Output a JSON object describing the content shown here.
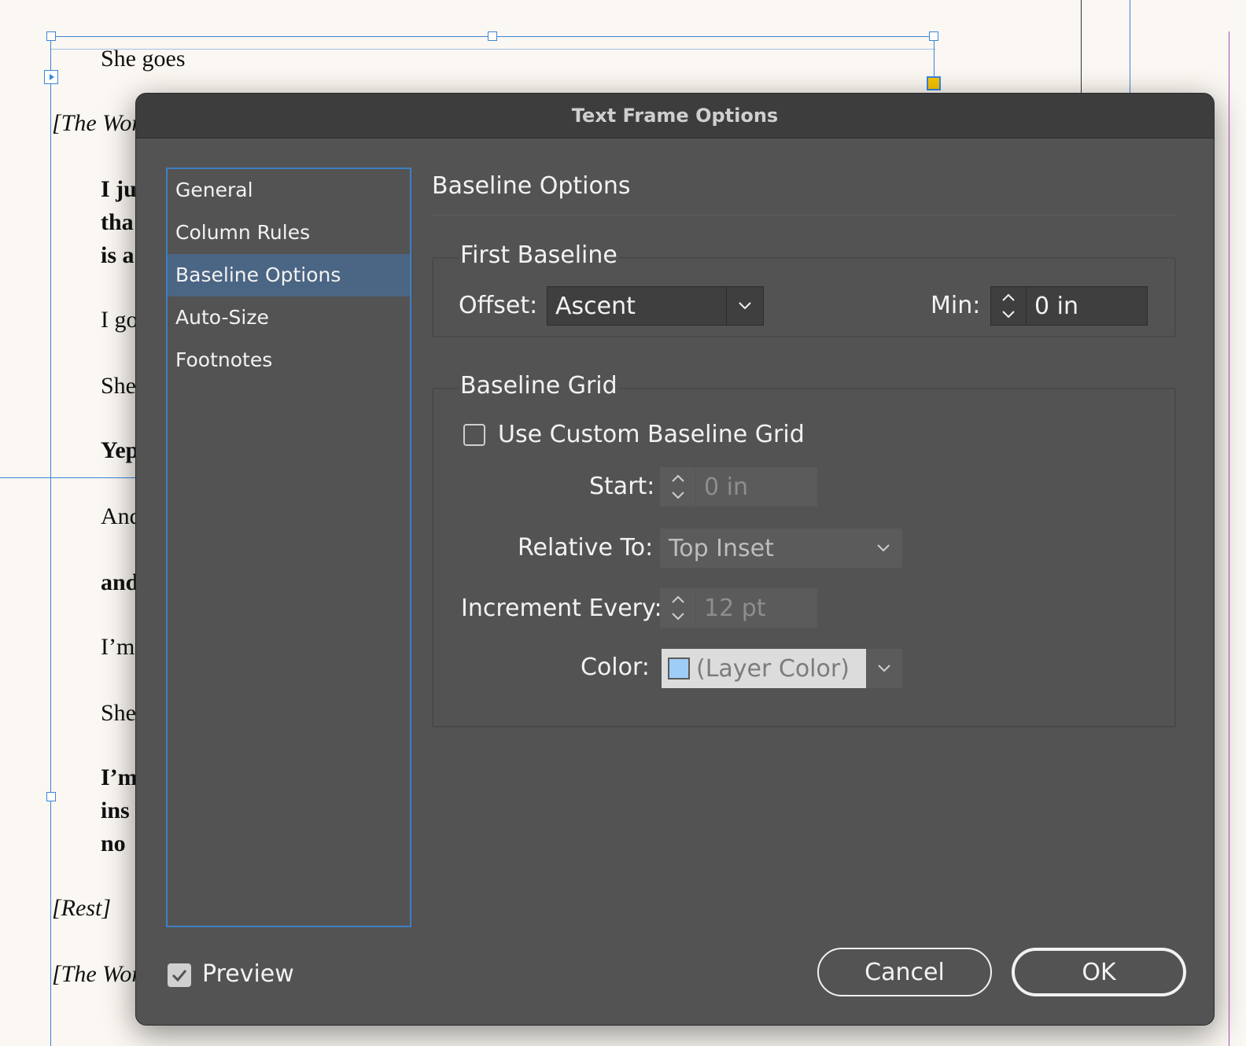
{
  "document": {
    "lines": [
      {
        "text": "She goes",
        "style": "normal"
      },
      {
        "text": "[The Wor",
        "style": "italic"
      },
      {
        "text": "I ju",
        "style": "bold"
      },
      {
        "text": "tha",
        "style": "bold"
      },
      {
        "text": "is a",
        "style": "bold"
      },
      {
        "text": "I go",
        "style": "normal"
      },
      {
        "text": "She",
        "style": "normal"
      },
      {
        "text": "Yep",
        "style": "bold"
      },
      {
        "text": "And",
        "style": "normal"
      },
      {
        "text": "and",
        "style": "bold"
      },
      {
        "text": "I’m",
        "style": "normal"
      },
      {
        "text": "She",
        "style": "normal"
      },
      {
        "text": "I’m",
        "style": "bold"
      },
      {
        "text": "ins",
        "style": "bold"
      },
      {
        "text": "no",
        "style": "bold"
      },
      {
        "text": "[Rest]",
        "style": "italic"
      },
      {
        "text": "[The Wor",
        "style": "italic"
      }
    ]
  },
  "dialog": {
    "title": "Text Frame Options",
    "nav": [
      {
        "label": "General",
        "selected": false
      },
      {
        "label": "Column Rules",
        "selected": false
      },
      {
        "label": "Baseline Options",
        "selected": true
      },
      {
        "label": "Auto-Size",
        "selected": false
      },
      {
        "label": "Footnotes",
        "selected": false
      }
    ],
    "section_title": "Baseline Options",
    "first_baseline": {
      "title": "First Baseline",
      "offset_label": "Offset:",
      "offset_value": "Ascent",
      "min_label": "Min:",
      "min_value": "0 in"
    },
    "baseline_grid": {
      "title": "Baseline Grid",
      "use_custom_label": "Use Custom Baseline Grid",
      "use_custom_checked": false,
      "start_label": "Start:",
      "start_value": "0 in",
      "relative_to_label": "Relative To:",
      "relative_to_value": "Top Inset",
      "increment_label": "Increment Every:",
      "increment_value": "12 pt",
      "color_label": "Color:",
      "color_value": "(Layer Color)",
      "color_swatch": "#9ecdf7"
    },
    "preview_label": "Preview",
    "preview_checked": true,
    "cancel_label": "Cancel",
    "ok_label": "OK"
  },
  "colors": {
    "dialog_bg": "#535353",
    "selection": "#4b6584",
    "guide": "#3b86d8",
    "frame_handle_fill": "#f5c400"
  }
}
